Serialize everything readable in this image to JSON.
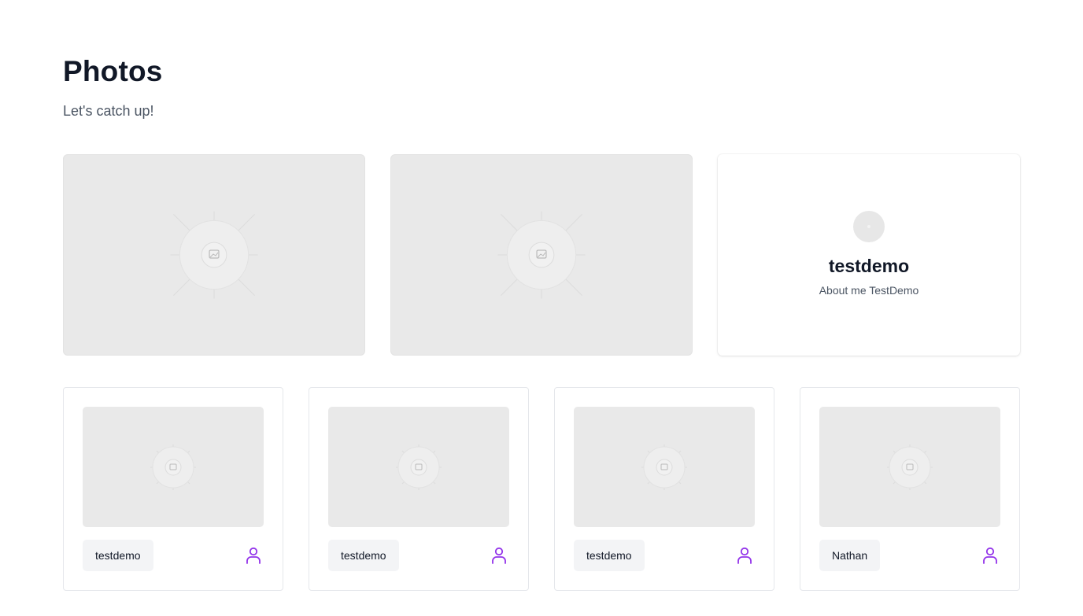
{
  "header": {
    "title": "Photos",
    "subtitle": "Let's catch up!"
  },
  "featured": [
    {
      "icon": "image-placeholder-icon"
    },
    {
      "icon": "image-placeholder-icon"
    }
  ],
  "profile": {
    "name": "testdemo",
    "about": "About me TestDemo",
    "avatar_icon": "avatar-placeholder"
  },
  "photos": [
    {
      "author": "testdemo",
      "icon": "user-icon"
    },
    {
      "author": "testdemo",
      "icon": "user-icon"
    },
    {
      "author": "testdemo",
      "icon": "user-icon"
    },
    {
      "author": "Nathan",
      "icon": "user-icon"
    }
  ],
  "colors": {
    "accent": "#9333ea",
    "placeholder_bg": "#e9e9e9",
    "chip_bg": "#f3f4f6"
  }
}
